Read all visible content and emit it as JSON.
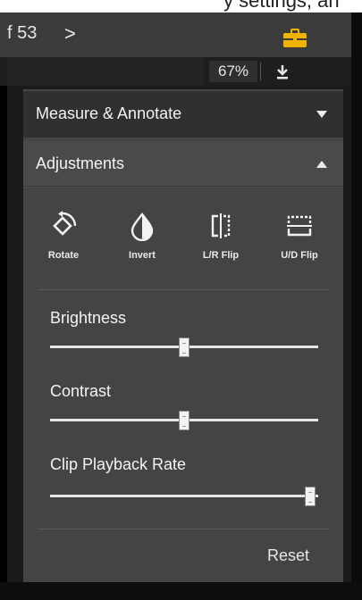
{
  "caption": {
    "text": "y settings, an"
  },
  "page_nav": {
    "counter": "f 53",
    "next_glyph": ">"
  },
  "toolbar": {
    "zoom": "67%",
    "icons": [
      "briefcase-icon",
      "download-icon"
    ],
    "accent": "#f0b400"
  },
  "panel": {
    "measure": {
      "title": "Measure & Annotate",
      "expanded": false
    },
    "adjustments": {
      "title": "Adjustments",
      "expanded": true
    },
    "tools": [
      {
        "label": "Rotate",
        "icon": "rotate-icon"
      },
      {
        "label": "Invert",
        "icon": "invert-icon"
      },
      {
        "label": "L/R Flip",
        "icon": "lr-flip-icon"
      },
      {
        "label": "U/D Flip",
        "icon": "ud-flip-icon"
      }
    ],
    "sliders": [
      {
        "label": "Brightness",
        "value": 0.5
      },
      {
        "label": "Contrast",
        "value": 0.5
      },
      {
        "label": "Clip Playback Rate",
        "value": 0.97
      }
    ],
    "reset_label": "Reset"
  }
}
